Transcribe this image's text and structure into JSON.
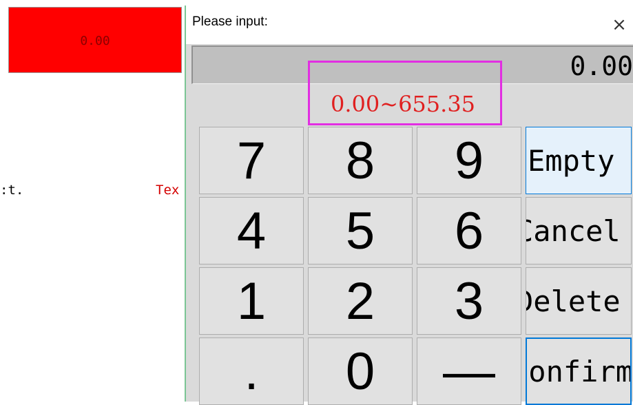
{
  "background": {
    "value_box": "0.00",
    "text_left": ":t.",
    "text_right": "Tex"
  },
  "dialog": {
    "title": "Please input:",
    "close_glyph": "×",
    "display_value": "0.00",
    "range": "0.00~655.35",
    "keys": [
      {
        "label": "7",
        "name": "key-7"
      },
      {
        "label": "8",
        "name": "key-8"
      },
      {
        "label": "9",
        "name": "key-9"
      },
      {
        "label": "4",
        "name": "key-4"
      },
      {
        "label": "5",
        "name": "key-5"
      },
      {
        "label": "6",
        "name": "key-6"
      },
      {
        "label": "1",
        "name": "key-1"
      },
      {
        "label": "2",
        "name": "key-2"
      },
      {
        "label": "3",
        "name": "key-3"
      },
      {
        "label": ".",
        "name": "key-decimal"
      },
      {
        "label": "0",
        "name": "key-0"
      },
      {
        "label": "—",
        "name": "key-minus"
      }
    ],
    "function_keys": [
      {
        "label": "Empty",
        "name": "empty-button"
      },
      {
        "label": "Cancel",
        "name": "cancel-button"
      },
      {
        "label": "Delete",
        "name": "delete-button"
      },
      {
        "label": "Confirm",
        "name": "confirm-button"
      }
    ]
  },
  "colors": {
    "value_box_bg": "#ff0000",
    "range_text": "#e02020",
    "highlight_border": "#e22ee2",
    "focus_border": "#0078d7"
  }
}
